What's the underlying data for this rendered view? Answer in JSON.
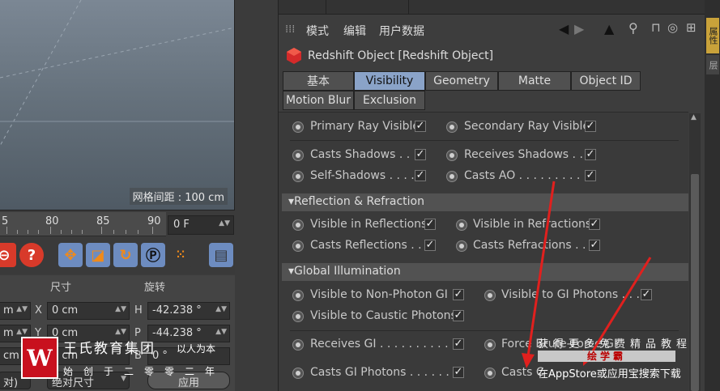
{
  "viewport": {
    "grid_spacing": "网格间距 : 100 cm"
  },
  "timeline": {
    "ticks": [
      "5",
      "80",
      "85",
      "90"
    ],
    "frame": "0 F"
  },
  "coords": {
    "header_size": "尺寸",
    "header_rotation": "旋转",
    "rows": [
      {
        "left": "m",
        "axis1": "X",
        "mid": "0 cm",
        "axis2": "H",
        "right": "-42.238 °"
      },
      {
        "left": "m",
        "axis1": "Y",
        "mid": "0 cm",
        "axis2": "P",
        "right": "-44.238 °"
      },
      {
        "left": "cm",
        "axis1": "Z",
        "mid": "0 cm",
        "axis2": "B",
        "right": "0 °"
      }
    ],
    "mode_left": "对)",
    "mode_mid": "绝对尺寸",
    "apply": "应用"
  },
  "logo": {
    "mark": "W",
    "title": "王氏教育集团",
    "subtitle": "以人为本",
    "tagline": "始创于二零零二年"
  },
  "am": {
    "menu": [
      "模式",
      "编辑",
      "用户数据"
    ],
    "object_title": "Redshift Object [Redshift Object]",
    "tabs_row1": [
      "基本",
      "Visibility",
      "Geometry",
      "Matte",
      "Object ID"
    ],
    "tabs_row2": [
      "Motion Blur",
      "Exclusion"
    ],
    "active_tab": "Visibility",
    "rows": {
      "primary_ray": "Primary Ray Visible",
      "secondary_ray": "Secondary Ray Visible",
      "casts_shadows": "Casts Shadows . . .",
      "receives_shadows": "Receives Shadows . . .",
      "self_shadows": "Self-Shadows . . . .",
      "casts_ao": "Casts AO . . . . . . . . . .",
      "vis_reflections": "Visible in Reflections",
      "vis_refractions": "Visible in Refractions",
      "casts_reflections": "Casts Reflections . . .",
      "casts_refractions": "Casts Refractions . . .",
      "vis_non_photon_gi": "Visible to Non-Photon GI",
      "vis_gi_photons": "Visible to GI Photons . . . .",
      "vis_caustic": "Visible to Caustic Photons",
      "receives_gi": "Receives GI . . . . . . . . . .",
      "force_brute": "Force Brute-Force GI",
      "casts_gi_photons": "Casts GI Photons . . . . . . .",
      "casts_caustic": "Casts C"
    },
    "sections": {
      "reflection": "▾Reflection & Refraction",
      "gi": "▾Global Illumination"
    }
  },
  "right_tabs": [
    "属性",
    "层"
  ],
  "watermark": {
    "line1": "获得更多免费精品教程",
    "bar": "绘学霸",
    "line2": "在AppStore或应用宝搜索下载"
  },
  "colors": {
    "accent_tab": "#8aa3c8",
    "logo_red": "#c8101e",
    "arrow_red": "#e0201e"
  }
}
